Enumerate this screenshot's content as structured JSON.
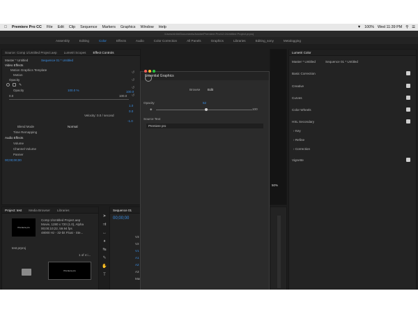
{
  "menubar": {
    "apple_icon": "apple-icon",
    "app_name": "Premiere Pro CC",
    "items": [
      "File",
      "Edit",
      "Clip",
      "Sequence",
      "Markers",
      "Graphics",
      "Window",
      "Help"
    ],
    "battery": "100%",
    "clock": "Wed 11:39 PM"
  },
  "window_title": "/Users/shhh/Documents/Adobe/Premiere Pro/12.0/Untitled Project.prproj",
  "workspaces": [
    "Assembly",
    "Editing",
    "Color",
    "Effects",
    "Audio",
    "Color Correction",
    "All Panels",
    "Graphics",
    "Libraries",
    "Editing_sony",
    "Metalogging"
  ],
  "active_workspace": "Color",
  "source_panel": {
    "tabs": [
      "Source: Comp 1/Untitled Project.aep",
      "Lumetri Scopes",
      "Effect Controls"
    ],
    "master_label": "Master * Untitled",
    "sequence_label": "Sequence 01 * Untitled",
    "video_effects": "Video Effects",
    "mogrt": "Motion Graphics Template",
    "motion": "Motion",
    "opacity": "Opacity",
    "opacity_sub": "Opacity",
    "opacity_value": "100.0 %",
    "range_lo": "0.0",
    "range_hi": "100.0",
    "graph_top": "100.0",
    "graph_val1": "1.0",
    "graph_val2": "0.0",
    "graph_val3": "-1.0",
    "velocity": "Velocity: 0.0 / second",
    "blend_mode_label": "Blend Mode",
    "blend_mode_value": "Normal",
    "time_remapping": "Time Remapping",
    "audio_effects": "Audio Effects",
    "volume": "Volume",
    "channel_volume": "Channel Volume",
    "panner": "Panner",
    "timecode": "00;00;00;00"
  },
  "project_panel": {
    "tabs": [
      "Project: test",
      "Media Browser",
      "Libraries"
    ],
    "clip_name": "Comp 1/Untitled Project.aep",
    "clip_info1": "Movie, 1280 x 720 (1.0), Alpha",
    "clip_info2": "00;00;10;22, 59.94 fps",
    "clip_info3": "48000 Hz - 32-bit Float - Ste...",
    "project_file": "test.prproj",
    "item_count": "1 of 4 i...",
    "thumb_text": "Premiere pro"
  },
  "timeline": {
    "tab": "Sequence 01",
    "timecode": "00;00;00",
    "tracks": [
      "V3",
      "V2",
      "V1",
      "A1",
      "A2",
      "A3",
      "Master"
    ]
  },
  "essential_graphics": {
    "title": "Essential Graphics",
    "browse": "Browse",
    "edit": "Edit",
    "opacity_label": "Opacity",
    "opacity_value": "52",
    "scale_value": "100",
    "source_text_label": "Source Text",
    "source_text_value": "Premiere pro",
    "opacity_fraction": 0.52
  },
  "lumetri": {
    "title": "Lumetri Color",
    "master_label": "Master * Untitled",
    "sequence_label": "Sequence 01 * Untitled",
    "sections": [
      "Basic Correction",
      "Creative",
      "Curves",
      "Color Wheels",
      "HSL Secondary"
    ],
    "hsl_subs": [
      "Key",
      "Refine",
      "Correction"
    ],
    "vignette": "Vignette"
  },
  "program_monitor": {
    "zoom": "50%"
  },
  "colors": {
    "accent": "#2d8ceb",
    "panel_bg": "#232323",
    "dock_bg": "#cfcfcf"
  }
}
